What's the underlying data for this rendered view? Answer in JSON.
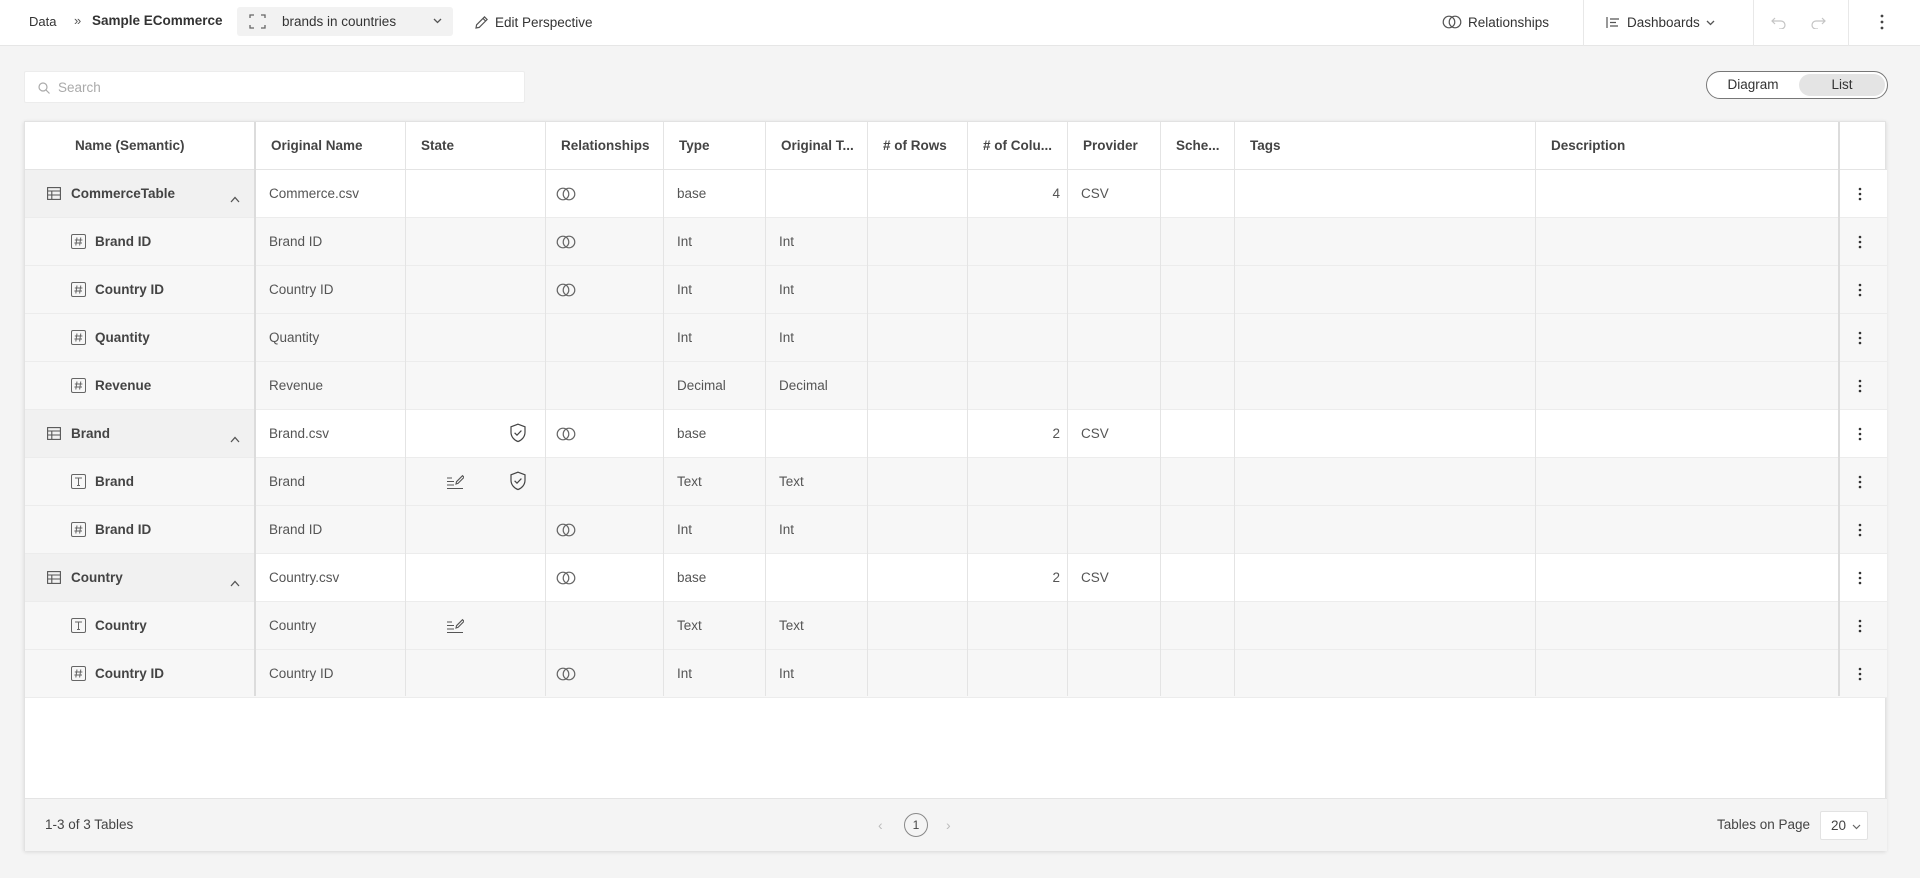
{
  "topbar": {
    "crumb_data": "Data",
    "crumb_sep": "»",
    "crumb_model": "Sample ECommerce",
    "perspective": "brands in countries",
    "edit_perspective": "Edit Perspective",
    "relationships": "Relationships",
    "dashboards": "Dashboards"
  },
  "search": {
    "placeholder": "Search",
    "value": ""
  },
  "view_toggle": {
    "diagram": "Diagram",
    "list": "List",
    "active": "List"
  },
  "columns": {
    "name": "Name (Semantic)",
    "original_name": "Original Name",
    "state": "State",
    "relationships": "Relationships",
    "type": "Type",
    "original_type": "Original T...",
    "rows": "# of Rows",
    "columns": "# of Colu...",
    "provider": "Provider",
    "schema": "Sche...",
    "tags": "Tags",
    "description": "Description"
  },
  "rows": [
    {
      "kind": "table",
      "name": "CommerceTable",
      "original_name": "Commerce.csv",
      "state_edit": false,
      "state_shield": false,
      "relationship": true,
      "type": "base",
      "original_type": "",
      "rows": "",
      "cols": "4",
      "provider": "CSV",
      "schema": "",
      "tags": "",
      "description": ""
    },
    {
      "kind": "field",
      "field_icon": "hash-icon",
      "name": "Brand ID",
      "original_name": "Brand ID",
      "state_edit": false,
      "state_shield": false,
      "relationship": true,
      "type": "Int",
      "original_type": "Int",
      "rows": "",
      "cols": "",
      "provider": "",
      "schema": "",
      "tags": "",
      "description": ""
    },
    {
      "kind": "field",
      "field_icon": "hash-icon",
      "name": "Country ID",
      "original_name": "Country ID",
      "state_edit": false,
      "state_shield": false,
      "relationship": true,
      "type": "Int",
      "original_type": "Int",
      "rows": "",
      "cols": "",
      "provider": "",
      "schema": "",
      "tags": "",
      "description": ""
    },
    {
      "kind": "field",
      "field_icon": "hash-icon",
      "name": "Quantity",
      "original_name": "Quantity",
      "state_edit": false,
      "state_shield": false,
      "relationship": false,
      "type": "Int",
      "original_type": "Int",
      "rows": "",
      "cols": "",
      "provider": "",
      "schema": "",
      "tags": "",
      "description": ""
    },
    {
      "kind": "field",
      "field_icon": "hash-icon",
      "name": "Revenue",
      "original_name": "Revenue",
      "state_edit": false,
      "state_shield": false,
      "relationship": false,
      "type": "Decimal",
      "original_type": "Decimal",
      "rows": "",
      "cols": "",
      "provider": "",
      "schema": "",
      "tags": "",
      "description": ""
    },
    {
      "kind": "table",
      "name": "Brand",
      "original_name": "Brand.csv",
      "state_edit": false,
      "state_shield": true,
      "relationship": true,
      "type": "base",
      "original_type": "",
      "rows": "",
      "cols": "2",
      "provider": "CSV",
      "schema": "",
      "tags": "",
      "description": ""
    },
    {
      "kind": "field",
      "field_icon": "text-icon",
      "name": "Brand",
      "original_name": "Brand",
      "state_edit": true,
      "state_shield": true,
      "relationship": false,
      "type": "Text",
      "original_type": "Text",
      "rows": "",
      "cols": "",
      "provider": "",
      "schema": "",
      "tags": "",
      "description": ""
    },
    {
      "kind": "field",
      "field_icon": "hash-icon",
      "name": "Brand ID",
      "original_name": "Brand ID",
      "state_edit": false,
      "state_shield": false,
      "relationship": true,
      "type": "Int",
      "original_type": "Int",
      "rows": "",
      "cols": "",
      "provider": "",
      "schema": "",
      "tags": "",
      "description": ""
    },
    {
      "kind": "table",
      "name": "Country",
      "original_name": "Country.csv",
      "state_edit": false,
      "state_shield": false,
      "relationship": true,
      "type": "base",
      "original_type": "",
      "rows": "",
      "cols": "2",
      "provider": "CSV",
      "schema": "",
      "tags": "",
      "description": ""
    },
    {
      "kind": "field",
      "field_icon": "text-icon",
      "name": "Country",
      "original_name": "Country",
      "state_edit": true,
      "state_shield": false,
      "relationship": false,
      "type": "Text",
      "original_type": "Text",
      "rows": "",
      "cols": "",
      "provider": "",
      "schema": "",
      "tags": "",
      "description": ""
    },
    {
      "kind": "field",
      "field_icon": "hash-icon",
      "name": "Country ID",
      "original_name": "Country ID",
      "state_edit": false,
      "state_shield": false,
      "relationship": true,
      "type": "Int",
      "original_type": "Int",
      "rows": "",
      "cols": "",
      "provider": "",
      "schema": "",
      "tags": "",
      "description": ""
    }
  ],
  "footer": {
    "count": "1-3 of 3 Tables",
    "current_page": "1",
    "tables_on_page_label": "Tables on Page",
    "tables_on_page": "20"
  }
}
